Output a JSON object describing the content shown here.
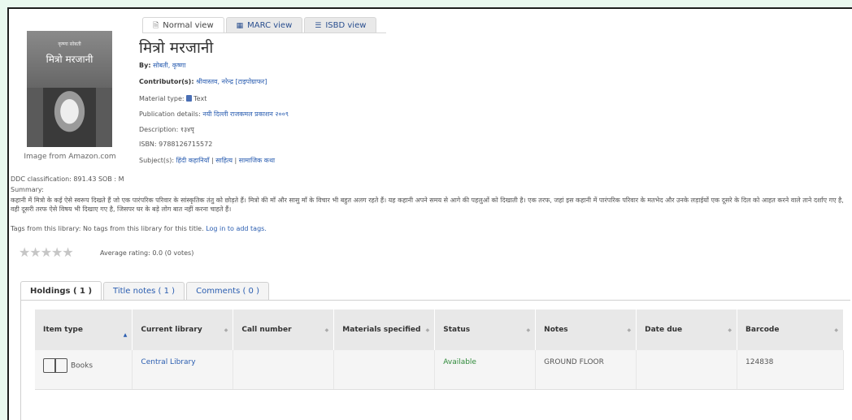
{
  "view_tabs": [
    {
      "label": "Normal view",
      "icon": "page-icon"
    },
    {
      "label": "MARC view",
      "icon": "grid-icon"
    },
    {
      "label": "ISBD view",
      "icon": "list-icon"
    }
  ],
  "cover": {
    "author": "कृष्णा सोबती",
    "title": "मित्रो मरजानी",
    "caption": "Image from Amazon.com"
  },
  "record": {
    "title": "मित्रो मरजानी",
    "by_label": "By:",
    "by_value": "सोबती, कृष्णा",
    "contrib_label": "Contributor(s):",
    "contrib_value": "श्रीवास्तव, नरेन्द्र [टाइपोग्राफर]",
    "material_label": "Material type:",
    "material_value": "Text",
    "pub_label": "Publication details:",
    "pub_value": "नयी दिल्ली राजकमल प्रकाशन २००९",
    "desc_label": "Description:",
    "desc_value": "१३४पृ",
    "isbn_label": "ISBN:",
    "isbn_value": "9788126715572",
    "subject_label": "Subject(s):",
    "subjects": [
      "हिंदी कहानियाँ",
      "साहित्य",
      "सामाजिक कथा"
    ],
    "ddc": "DDC classification: 891.43 SOB : M",
    "summary_label": "Summary:",
    "summary": "कहानी में मित्रो के कई ऐसे स्वरूप दिखते हैं जो एक पारंपरिक परिवार के सांस्कृतिक तंतु को छोड़ते हैं। मित्रो की माँ और सासु माँ के विचार भी बहुत अलग रहते हैं। यह कहानी अपने समय से आगे की पहलुओं को दिखाती है। एक तरफ, जहां इस कहानी में पारंपरिक परिवार के मतभेद और उनके लड़ाईयों एक दूसरे के दिल को आहत करने वाले ताने दर्शाए गए है, वही दूसरी तरफ ऐसे विषय भी दिखाए गए है, जिसपर घर के बड़े लोग बात नहीं करना चाहते हैं।",
    "tags_prefix": "Tags from this library: No tags from this library for this title.",
    "tags_link": "Log in to add tags.",
    "avg_rating": "Average rating: 0.0 (0 votes)",
    "stars": "★★★★★",
    "rating_value": 0
  },
  "holdings_tabs": [
    "Holdings ( 1 )",
    "Title notes ( 1 )",
    "Comments ( 0 )"
  ],
  "holdings": {
    "columns": [
      "Item type",
      "Current library",
      "Call number",
      "Materials specified",
      "Status",
      "Notes",
      "Date due",
      "Barcode"
    ],
    "rows": [
      {
        "item_type": "Books",
        "current_library": "Central Library",
        "call_number": "",
        "materials_specified": "",
        "status": "Available",
        "notes": "GROUND FLOOR",
        "date_due": "",
        "barcode": "124838"
      }
    ]
  },
  "colors": {
    "link": "#2a5db0",
    "available": "#2f8a3a",
    "background": "#e9f8ef"
  }
}
